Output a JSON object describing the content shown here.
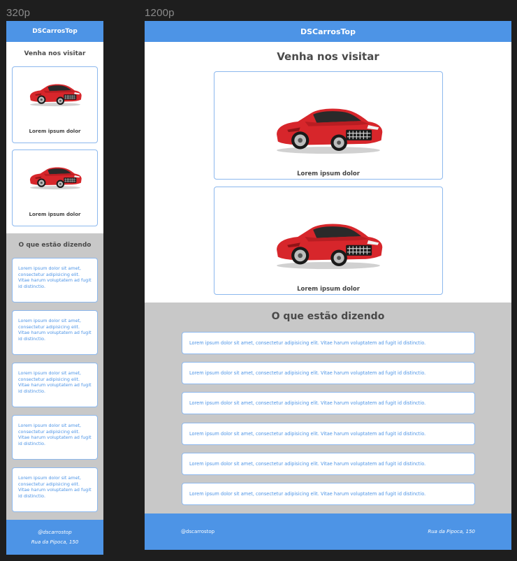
{
  "frames": {
    "mobile_label": "320p",
    "desktop_label": "1200p"
  },
  "site": {
    "brand": "DSCarrosTop",
    "visit_title": "Venha nos visitar",
    "reviews_title": "O que estão dizendo"
  },
  "cars": [
    {
      "caption": "Lorem ipsum dolor",
      "icon": "red-sports-car-image"
    },
    {
      "caption": "Lorem ipsum dolor",
      "icon": "red-sports-car-image"
    }
  ],
  "reviews": [
    "Lorem ipsum dolor sit amet, consectetur adipisicing elit. Vitae harum voluptatem ad fugit id distinctio.",
    "Lorem ipsum dolor sit amet, consectetur adipisicing elit. Vitae harum voluptatem ad fugit id distinctio.",
    "Lorem ipsum dolor sit amet, consectetur adipisicing elit. Vitae harum voluptatem ad fugit id distinctio.",
    "Lorem ipsum dolor sit amet, consectetur adipisicing elit. Vitae harum voluptatem ad fugit id distinctio.",
    "Lorem ipsum dolor sit amet, consectetur adipisicing elit. Vitae harum voluptatem ad fugit id distinctio.",
    "Lorem ipsum dolor sit amet, consectetur adipisicing elit. Vitae harum voluptatem ad fugit id distinctio."
  ],
  "footer": {
    "handle": "@dscarrostop",
    "address": "Rua da Pipoca, 150"
  },
  "colors": {
    "canvas": "#1e1e1e",
    "brand_blue": "#4d94e6",
    "card_border": "#8cb8ee",
    "reviews_bg": "#c8c8c8",
    "car_red": "#d7262b"
  }
}
